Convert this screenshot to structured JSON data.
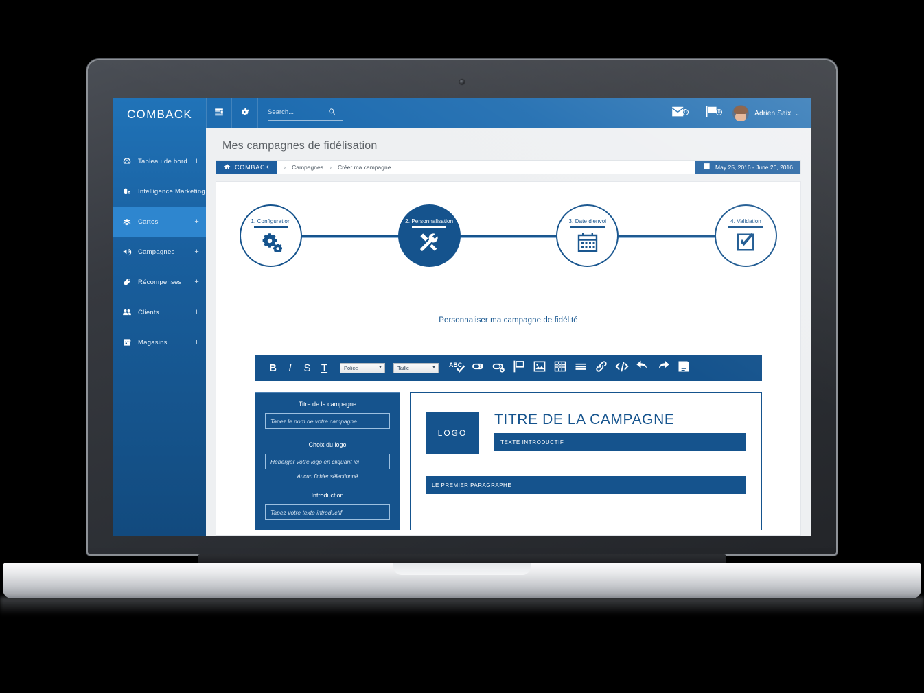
{
  "brand": {
    "logo_text": "COMBACK"
  },
  "sidebar": {
    "items": [
      {
        "label": "Tableau de bord",
        "icon": "dashboard-icon",
        "expand": "+",
        "active": false
      },
      {
        "label": "Intelligence Marketing",
        "icon": "brain-icon",
        "expand": "+",
        "active": false
      },
      {
        "label": "Cartes",
        "icon": "cards-icon",
        "expand": "+",
        "active": true
      },
      {
        "label": "Campagnes",
        "icon": "megaphone-icon",
        "expand": "+",
        "active": false
      },
      {
        "label": "Récompenses",
        "icon": "tag-icon",
        "expand": "+",
        "active": false
      },
      {
        "label": "Clients",
        "icon": "users-icon",
        "expand": "+",
        "active": false
      },
      {
        "label": "Magasins",
        "icon": "store-icon",
        "expand": "+",
        "active": false
      }
    ]
  },
  "topbar": {
    "menu_icon": "menu-list-icon",
    "settings_icon": "gear-icon",
    "search": {
      "placeholder": "Search...",
      "value": "",
      "icon": "search-icon"
    },
    "messages": {
      "icon": "envelope-icon",
      "count": "0"
    },
    "notifications": {
      "icon": "flag-icon",
      "count": "0"
    },
    "user": {
      "name": "Adrien Saix",
      "caret": "⌄",
      "avatar": "user-avatar"
    }
  },
  "page": {
    "title": "Mes campagnes de fidélisation"
  },
  "breadcrumb": {
    "home_label": "COMBACK",
    "home_icon": "home-icon",
    "separator": "›",
    "items": [
      {
        "label": "Campagnes",
        "link": true
      },
      {
        "label": "Créer ma campagne",
        "link": false
      }
    ],
    "date_range": {
      "icon": "calendar-icon",
      "label": "May 25, 2016 - June 26, 2016"
    }
  },
  "stepper": {
    "steps": [
      {
        "label": "1. Configuration",
        "icon": "gears-icon",
        "active": false
      },
      {
        "label": "2. Personnalisation",
        "icon": "tools-icon",
        "active": true
      },
      {
        "label": "3. Date d'envoi",
        "icon": "calendar-icon",
        "active": false
      },
      {
        "label": "4. Validation",
        "icon": "checkbox-check-icon",
        "active": false
      }
    ]
  },
  "section": {
    "title": "Personnaliser ma campagne de fidélité"
  },
  "toolbar": {
    "bold": "B",
    "italic": "I",
    "strike": "S",
    "underline": "T",
    "font_select": {
      "label": "Police",
      "arrow": "▼"
    },
    "size_select": {
      "label": "Taille",
      "arrow": "▼"
    },
    "buttons": [
      {
        "name": "spellcheck-icon",
        "title": "ABC"
      },
      {
        "name": "link-icon",
        "title": "Lien"
      },
      {
        "name": "unlink-icon",
        "title": "Supprimer lien"
      },
      {
        "name": "anchor-flag-icon",
        "title": "Ancre"
      },
      {
        "name": "image-icon",
        "title": "Image"
      },
      {
        "name": "table-icon",
        "title": "Tableau"
      },
      {
        "name": "horizontal-rule-icon",
        "title": "Ligne"
      },
      {
        "name": "attach-link-icon",
        "title": "Attacher"
      },
      {
        "name": "source-code-icon",
        "title": "Code source"
      },
      {
        "name": "undo-icon",
        "title": "Annuler"
      },
      {
        "name": "redo-icon",
        "title": "Rétablir"
      },
      {
        "name": "save-icon",
        "title": "Enregistrer"
      }
    ]
  },
  "form": {
    "title_label": "Titre de la campagne",
    "title_placeholder": "Tapez le nom de votre campagne",
    "title_value": "",
    "logo_label": "Choix du logo",
    "logo_placeholder": "Heberger votre logo en cliquant ici",
    "logo_value": "",
    "logo_note": "Aucun fichier sélectionné",
    "intro_label": "Introduction",
    "intro_placeholder": "Tapez votre texte introductif",
    "intro_value": ""
  },
  "preview": {
    "logo_text": "LOGO",
    "title": "TITRE DE LA CAMPAGNE",
    "intro": "TEXTE INTRODUCTIF",
    "paragraph": "LE PREMIER PARAGRAPHE"
  },
  "colors": {
    "brand_blue": "#1e6cb0",
    "deep_blue": "#15538d",
    "sidebar_top": "#2073b8",
    "sidebar_bottom": "#124a7e",
    "active_nav": "#2e86cf",
    "page_bg": "#eef0f2"
  }
}
